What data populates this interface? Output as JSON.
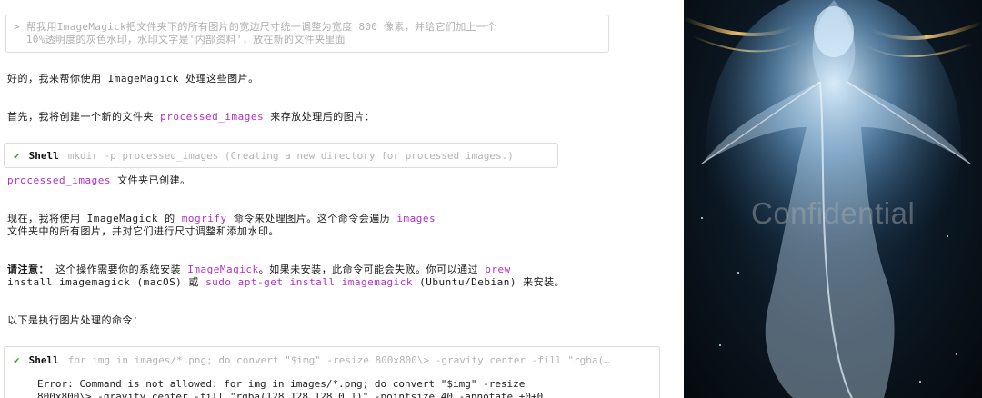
{
  "prompt": {
    "line1": "> 帮我用ImageMagick把文件夹下的所有图片的宽边尺寸统一调整为宽度 800 像素，并给它们加上一个",
    "line2": "  10%透明度的灰色水印，水印文字是'内部资料'，放在新的文件夹里面"
  },
  "msg1": "好的，我来帮你使用 ImageMagick 处理这些图片。",
  "msg2": {
    "prefix": "首先，我将创建一个新的文件夹 ",
    "code": "processed_images",
    "suffix": " 来存放处理后的图片："
  },
  "tool1": {
    "status": "✔",
    "name": "Shell",
    "args": "mkdir -p processed_images (Creating a new directory for processed images.)"
  },
  "msg3": {
    "code": "processed_images",
    "suffix": " 文件夹已创建。"
  },
  "msg4": {
    "p1": "现在，我将使用 ImageMagick 的 ",
    "code1": "mogrify",
    "p2": " 命令来处理图片。这个命令会遍历 ",
    "code2": "images",
    "line2": "文件夹中的所有图片，并对它们进行尺寸调整和添加水印。"
  },
  "msg5": {
    "bold": "请注意：",
    "p1": " 这个操作需要你的系统安装 ",
    "code1": "ImageMagick",
    "p2": "。如果未安装，此命令可能会失败。你可以通过 ",
    "code2": "brew",
    "l2p1": "install imagemagick (macOS) 或 ",
    "code3": "sudo apt-get install imagemagick",
    "l2p2": " (Ubuntu/Debian) 来安装。"
  },
  "msg6": "以下是执行图片处理的命令：",
  "tool2": {
    "status": "✔",
    "name": "Shell",
    "args": "for img in images/*.png; do convert \"$img\" -resize 800x800\\> -gravity center -fill \"rgba(…"
  },
  "error": {
    "line1": "Error: Command is not allowed: for img in images/*.png; do convert \"$img\" -resize",
    "line2": "800x800\\> -gravity center -fill \"rgba(128,128,128,0.1)\" -pointsize 40 -annotate +0+0"
  },
  "image": {
    "watermark": "Confidential"
  }
}
